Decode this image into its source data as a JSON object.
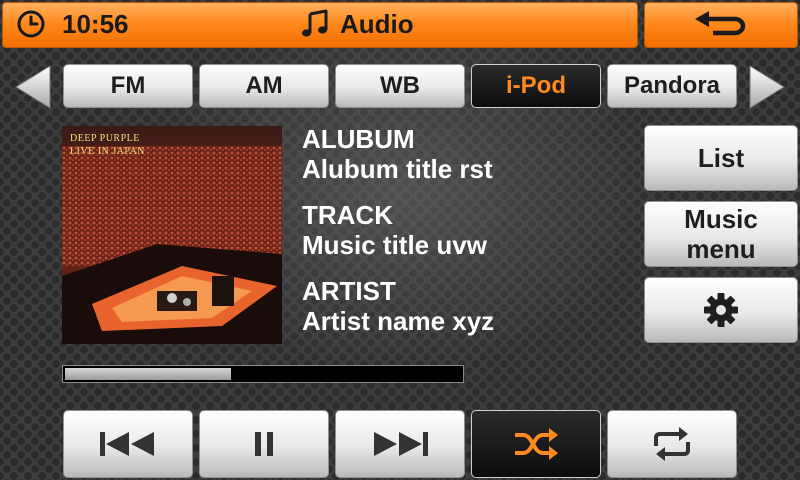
{
  "header": {
    "time": "10:56",
    "title": "Audio",
    "clock_icon": "clock-icon",
    "title_icon": "music-note-icon",
    "back_icon": "back-arrow-icon"
  },
  "tabs": [
    {
      "label": "FM",
      "active": false
    },
    {
      "label": "AM",
      "active": false
    },
    {
      "label": "WB",
      "active": false
    },
    {
      "label": "i-Pod",
      "active": true
    },
    {
      "label": "Pandora",
      "active": false
    }
  ],
  "album_art": {
    "text": "DEEP PURPLE\nLIVE IN JAPAN"
  },
  "info": {
    "album_label": "ALUBUM",
    "album_value": "Alubum title rst",
    "track_label": "TRACK",
    "track_value": "Music title uvw",
    "artist_label": "ARTIST",
    "artist_value": "Artist name xyz"
  },
  "side_buttons": {
    "list": "List",
    "music_menu": "Music\nmenu",
    "settings_icon": "gear-icon"
  },
  "progress": {
    "fraction": 0.42
  },
  "controls": [
    {
      "icon": "previous-track-icon",
      "active": false
    },
    {
      "icon": "pause-icon",
      "active": false
    },
    {
      "icon": "next-track-icon",
      "active": false
    },
    {
      "icon": "shuffle-icon",
      "active": true
    },
    {
      "icon": "repeat-icon",
      "active": false
    }
  ],
  "colors": {
    "accent": "#ff8a1e",
    "header_dark_text": "#1a1a1a",
    "button_light": "#e8e8e8",
    "button_active_bg": "#111111"
  }
}
